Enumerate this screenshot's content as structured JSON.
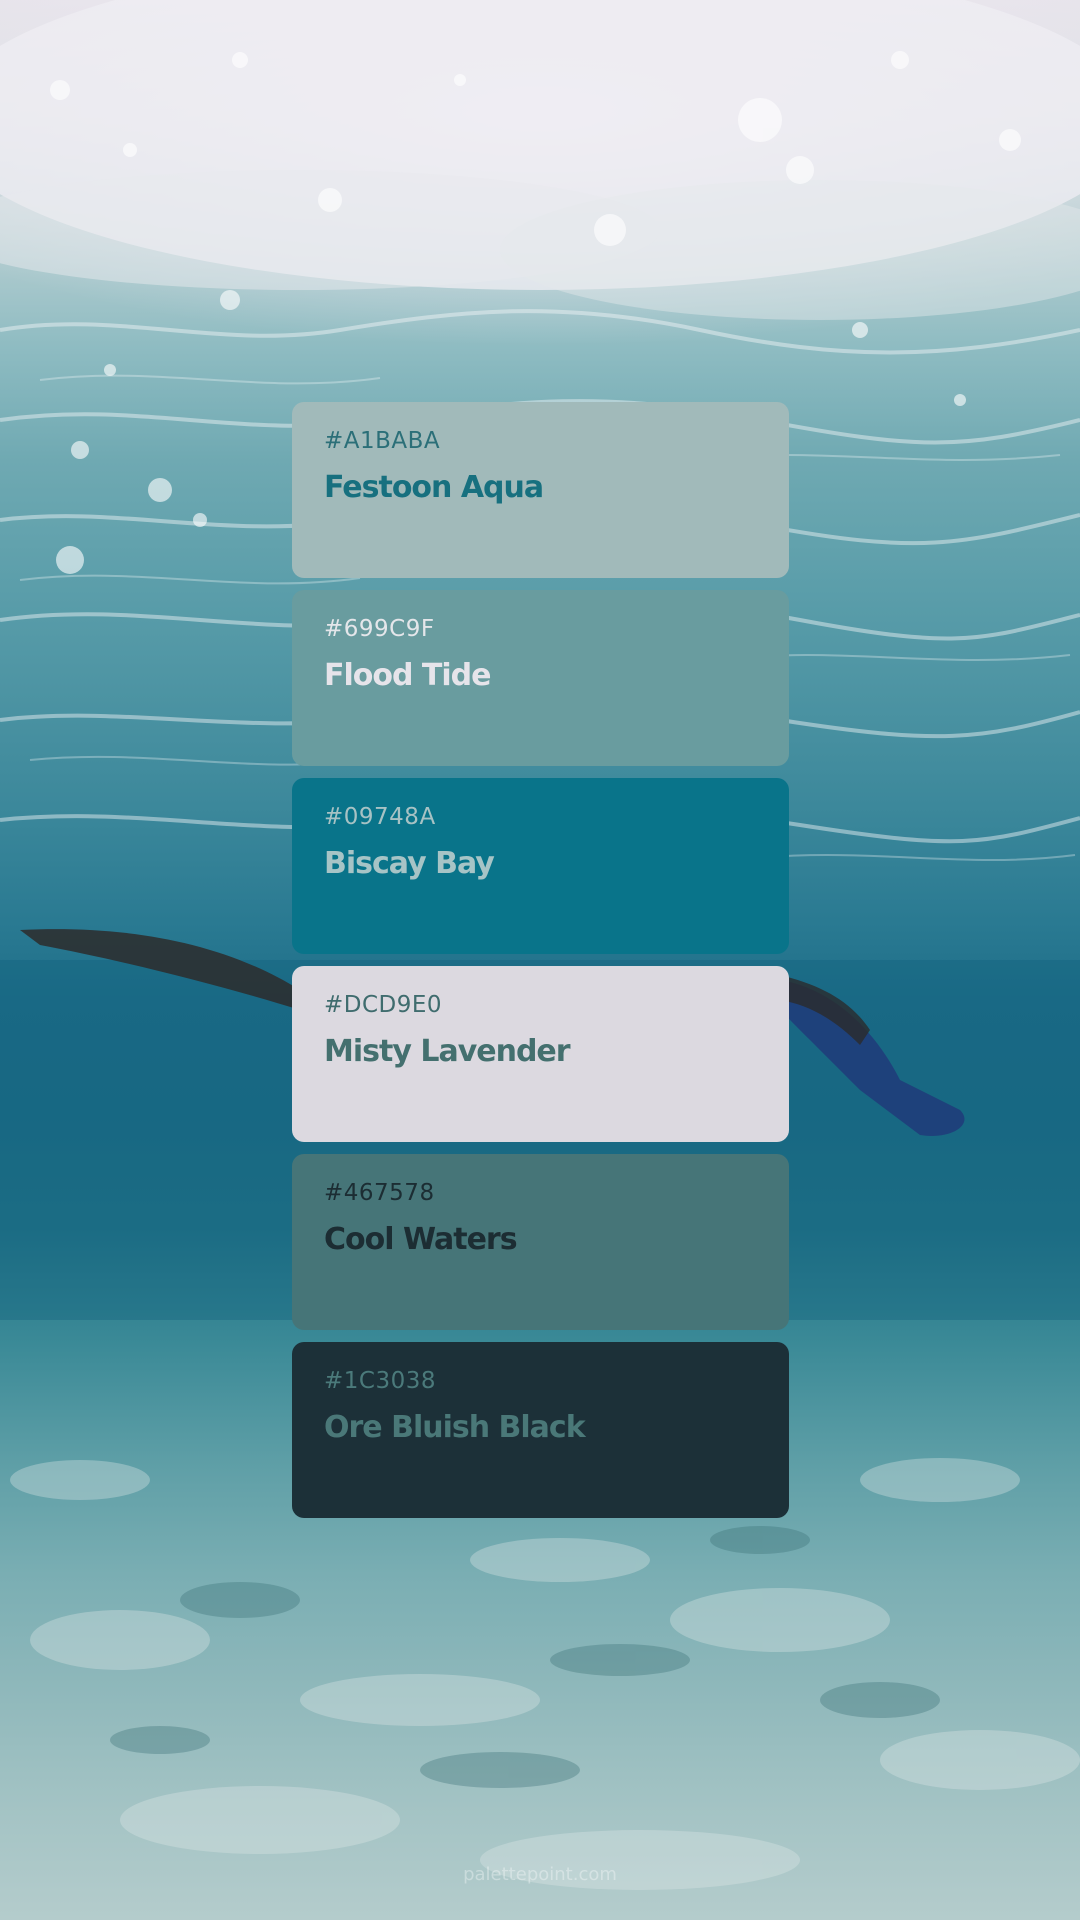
{
  "background": {
    "description_icon": "underwater-snorkeler-photo",
    "colors": {
      "surface": "#e6e3ea",
      "mid_water": "#1f6f8a",
      "sea_floor": "#b4cccc"
    }
  },
  "palette": [
    {
      "hex": "#A1BABA",
      "name": "Festoon Aqua",
      "bg": "#A1BABA",
      "hex_color": "#2b6f78",
      "name_color": "#17707f"
    },
    {
      "hex": "#699C9F",
      "name": "Flood Tide",
      "bg": "#699C9F",
      "hex_color": "#e4e6ea",
      "name_color": "#e6e4ea"
    },
    {
      "hex": "#09748A",
      "name": "Biscay Bay",
      "bg": "#09748A",
      "hex_color": "#a7c2c4",
      "name_color": "#a7c4c6"
    },
    {
      "hex": "#DCD9E0",
      "name": "Misty Lavender",
      "bg": "#DCD9E0",
      "hex_color": "#3f6c6e",
      "name_color": "#44706f"
    },
    {
      "hex": "#467578",
      "name": "Cool Waters",
      "bg": "#467578",
      "hex_color": "#1c2d33",
      "name_color": "#1c2d33"
    },
    {
      "hex": "#1C3038",
      "name": "Ore Bluish Black",
      "bg": "#1C3038",
      "hex_color": "#4b7a7b",
      "name_color": "#4a7878"
    }
  ],
  "footer": "palettepoint.com"
}
